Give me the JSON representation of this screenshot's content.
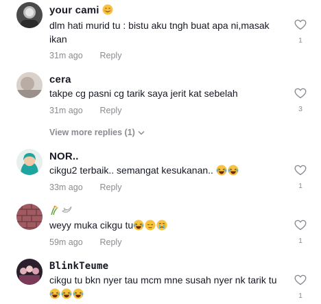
{
  "comments": [
    {
      "username": "your cami",
      "username_emoji": "smiling-face-icon",
      "text": "dlm hati murid tu : bistu aku tngh buat apa ni,masak ikan",
      "time": "31m ago",
      "reply_label": "Reply",
      "likes": "1"
    },
    {
      "username": "cera",
      "text": "takpe cg pasni cg tarik saya jerit kat sebelah",
      "time": "31m ago",
      "reply_label": "Reply",
      "likes": "3"
    },
    {
      "username": "NOR..",
      "text": "cikgu2 terbaik.. semangat kesukanan..",
      "text_emojis": [
        "laughing-crying-face-icon",
        "laughing-crying-face-icon"
      ],
      "time": "33m ago",
      "reply_label": "Reply",
      "likes": "1"
    },
    {
      "username": "",
      "username_emojis": [
        "rice-plant-icon",
        "dove-icon"
      ],
      "text": "weyy muka cikgu tu",
      "text_emojis": [
        "laughing-crying-face-icon",
        "relieved-face-icon",
        "crying-face-icon"
      ],
      "time": "59m ago",
      "reply_label": "Reply",
      "likes": "1"
    },
    {
      "username": "BlinkTeume",
      "text": "cikgu tu bkn nyer tau mcm mne susah nyer nk tarik tu",
      "text_emojis": [
        "laughing-crying-face-icon",
        "laughing-crying-face-icon",
        "laughing-crying-face-icon"
      ],
      "likes": "1"
    }
  ],
  "view_more_replies": "View more replies (1)",
  "colors": {
    "text": "#161823",
    "muted": "#8a8b91",
    "emoji_yellow": "#f7c23c"
  }
}
